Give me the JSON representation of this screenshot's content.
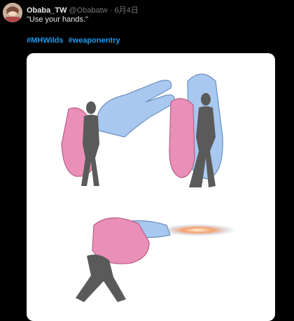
{
  "tweet": {
    "display_name": "Obaba_TW",
    "handle": "@Obabatw",
    "separator": "·",
    "date": "6月4日",
    "text": "\"Use your hands.\"",
    "hashtags": [
      "#MHWilds",
      "#weaponentry"
    ]
  },
  "media": {
    "alt": "sketch of figures using giant hands",
    "colors": {
      "pink_hand": "#e98fb8",
      "blue_hand": "#a8c8f0",
      "figure": "#5a5a5a"
    }
  }
}
